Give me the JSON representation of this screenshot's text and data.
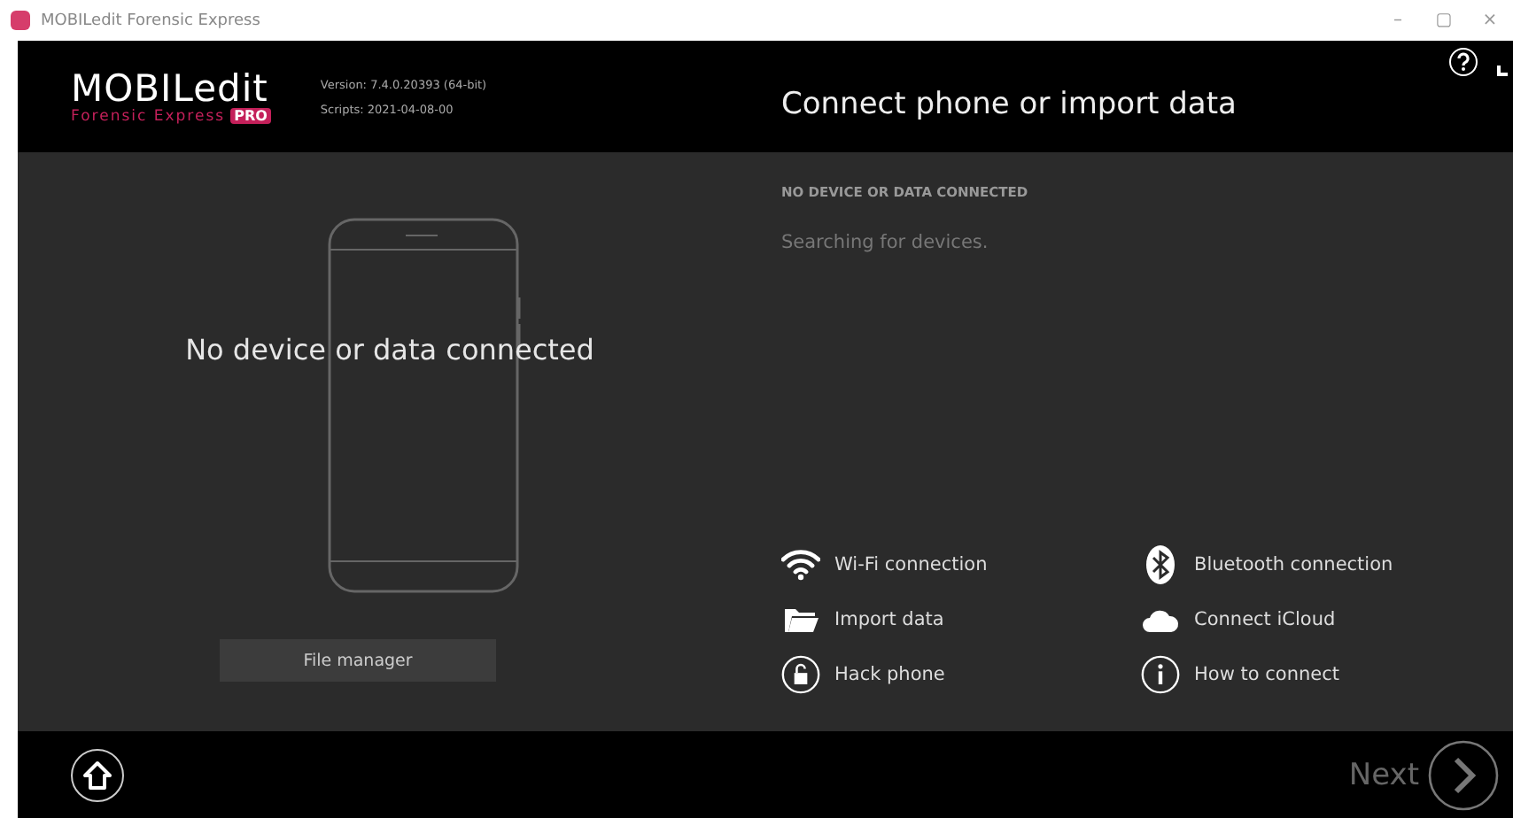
{
  "window": {
    "title": "MOBILedit Forensic Express",
    "controls": [
      "–",
      "▢",
      "×"
    ]
  },
  "header": {
    "logo": {
      "name": "MOBILedit",
      "subtitle": "Forensic Express",
      "badge": "PRO"
    },
    "version": "Version: 7.4.0.20393 (64-bit)",
    "scripts": "Scripts: 2021-04-08-00",
    "title": "Connect phone or import data"
  },
  "device_panel": {
    "message": "No device or data connected",
    "button": "File manager"
  },
  "status": {
    "heading": "NO DEVICE OR DATA CONNECTED",
    "message": "Searching for devices."
  },
  "options": [
    {
      "kind": "wifi",
      "label": "Wi-Fi connection"
    },
    {
      "kind": "bluetooth",
      "label": "Bluetooth connection"
    },
    {
      "kind": "folder",
      "label": "Import data"
    },
    {
      "kind": "cloud",
      "label": "Connect iCloud"
    },
    {
      "kind": "lock",
      "label": "Hack phone"
    },
    {
      "kind": "info",
      "label": "How to connect"
    }
  ],
  "footer": {
    "next": "Next"
  }
}
